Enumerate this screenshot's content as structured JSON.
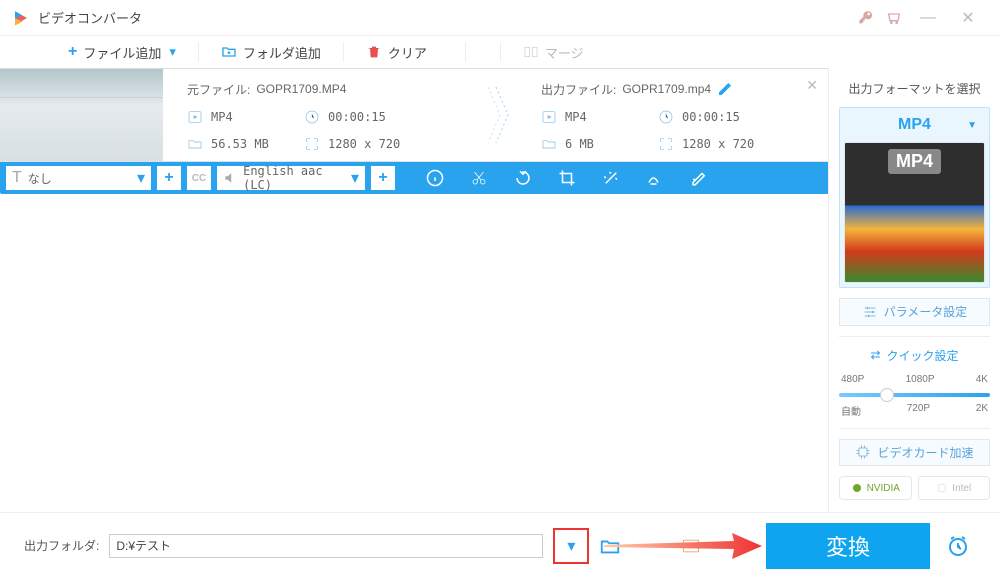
{
  "title": "ビデオコンバータ",
  "toolbar": {
    "add_file": "ファイル追加",
    "add_folder": "フォルダ追加",
    "clear": "クリア",
    "merge": "マージ"
  },
  "item": {
    "src": {
      "header_label": "元ファイル:",
      "filename": "GOPR1709.MP4",
      "format": "MP4",
      "duration": "00:00:15",
      "size": "56.53 MB",
      "resolution": "1280 x 720"
    },
    "dst": {
      "header_label": "出力ファイル:",
      "filename": "GOPR1709.mp4",
      "format": "MP4",
      "duration": "00:00:15",
      "size": "6 MB",
      "resolution": "1280 x 720"
    },
    "subtitle": {
      "value": "なし"
    },
    "audio": {
      "value": "English aac (LC)"
    }
  },
  "sidebar": {
    "title": "出力フォーマットを選択",
    "format": "MP4",
    "param_btn": "パラメータ設定",
    "quick_title": "クイック設定",
    "quality_top": [
      "480P",
      "1080P",
      "4K"
    ],
    "quality_bottom": [
      "自動",
      "720P",
      "2K"
    ],
    "gpu_btn": "ビデオカード加速",
    "gpu_nvidia": "NVIDIA",
    "gpu_intel": "Intel"
  },
  "bottom": {
    "out_label": "出力フォルダ:",
    "out_path": "D:¥テスト",
    "convert": "変換"
  }
}
